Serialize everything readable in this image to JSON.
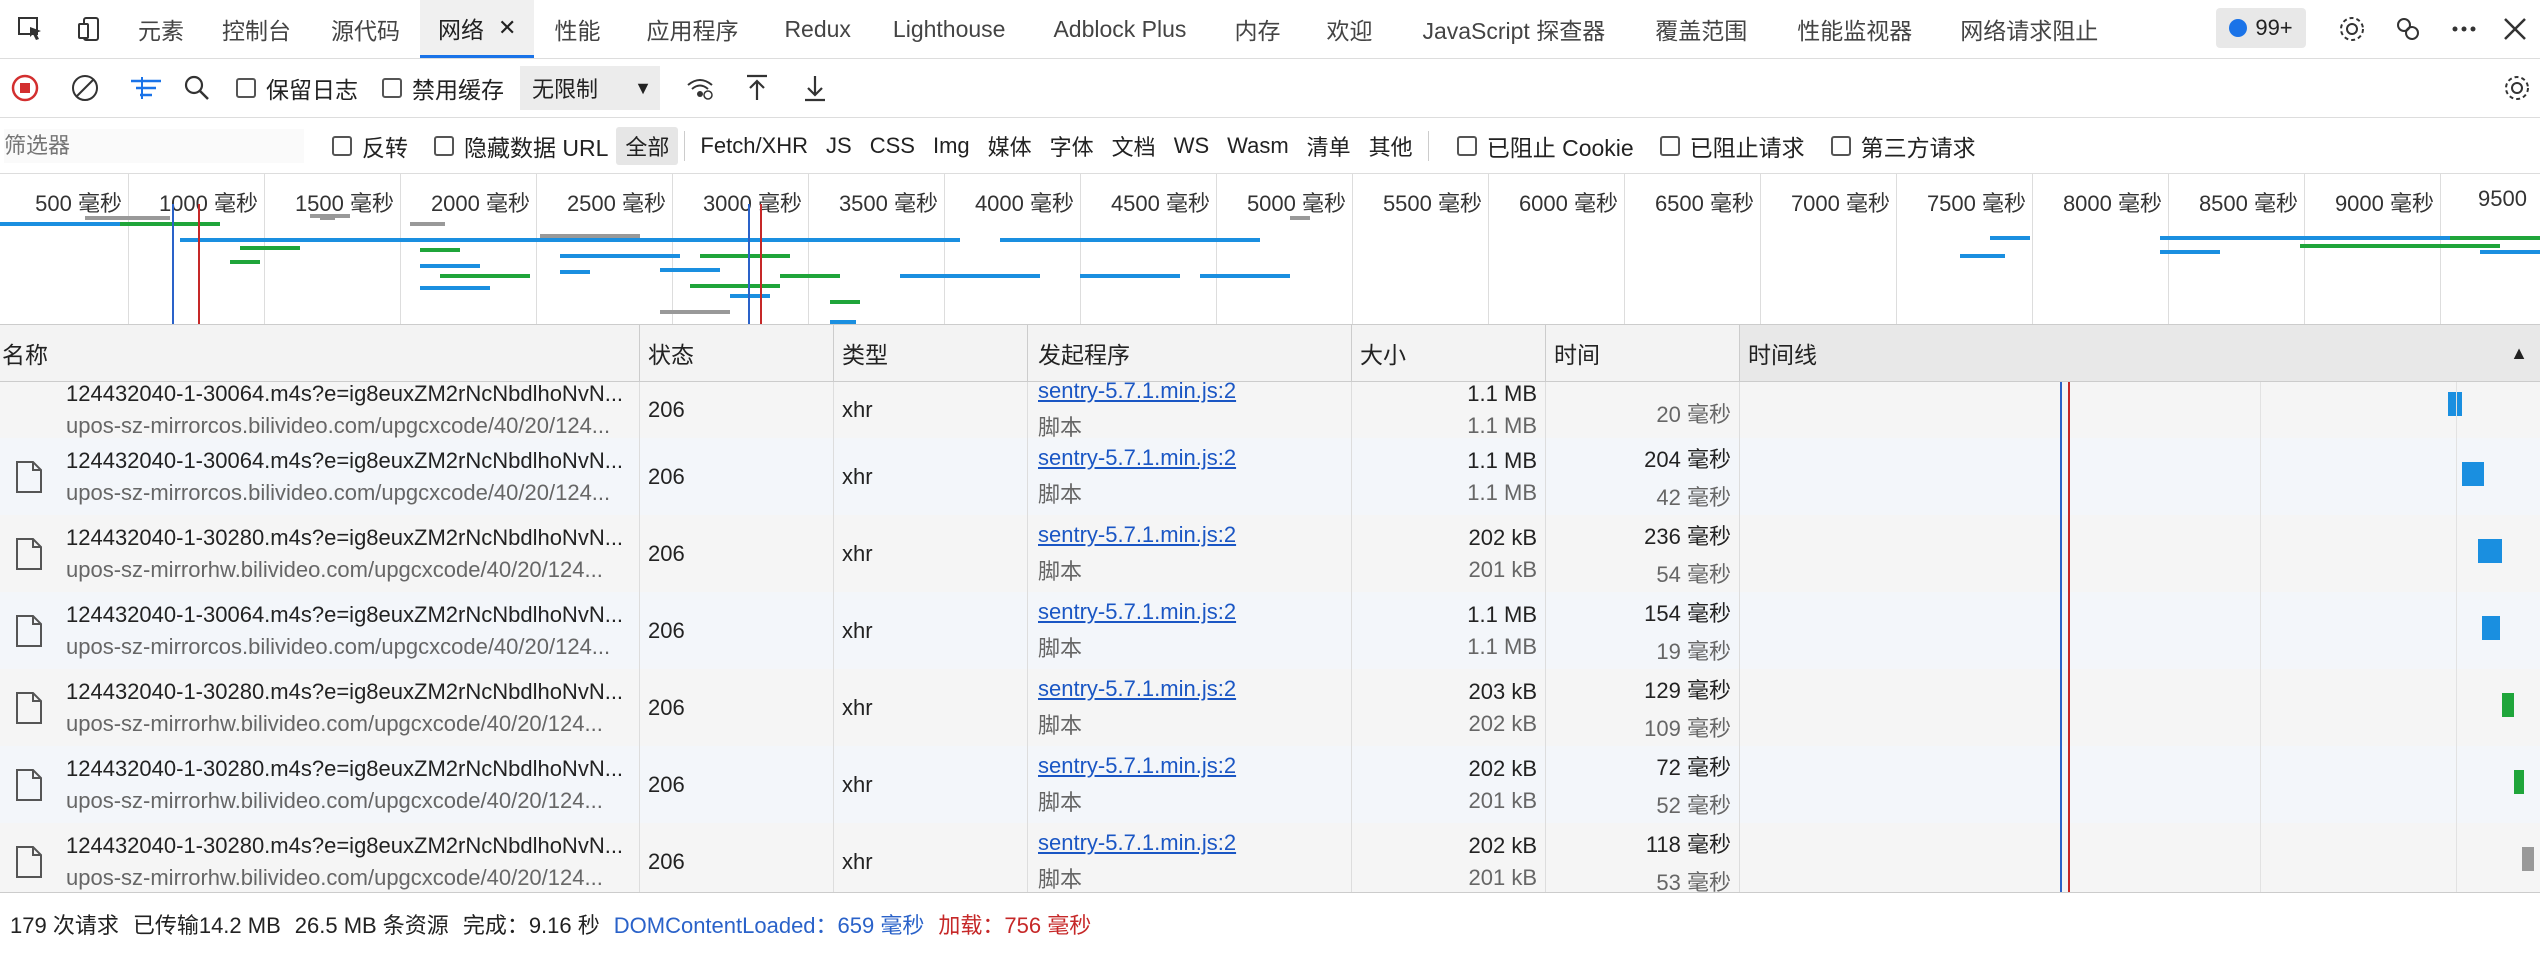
{
  "tabs": [
    {
      "label": "元素"
    },
    {
      "label": "控制台"
    },
    {
      "label": "源代码"
    },
    {
      "label": "网络",
      "active": true
    },
    {
      "label": "性能"
    },
    {
      "label": "应用程序"
    },
    {
      "label": "Redux"
    },
    {
      "label": "Lighthouse"
    },
    {
      "label": "Adblock Plus"
    },
    {
      "label": "内存"
    },
    {
      "label": "欢迎"
    },
    {
      "label": "JavaScript 探查器"
    },
    {
      "label": "覆盖范围"
    },
    {
      "label": "性能监视器"
    },
    {
      "label": "网络请求阻止"
    }
  ],
  "issues_badge": "99+",
  "toolbar": {
    "preserve_log": "保留日志",
    "disable_cache": "禁用缓存",
    "throttling": "无限制"
  },
  "filterbar": {
    "placeholder": "筛选器",
    "invert": "反转",
    "hide_data_url": "隐藏数据 URL",
    "types": [
      "全部",
      "Fetch/XHR",
      "JS",
      "CSS",
      "Img",
      "媒体",
      "字体",
      "文档",
      "WS",
      "Wasm",
      "清单",
      "其他"
    ],
    "blocked_cookies": "已阻止 Cookie",
    "blocked_requests": "已阻止请求",
    "third_party": "第三方请求"
  },
  "overview_ticks": [
    "500 毫秒",
    "1000 毫秒",
    "1500 毫秒",
    "2000 毫秒",
    "2500 毫秒",
    "3000 毫秒",
    "3500 毫秒",
    "4000 毫秒",
    "4500 毫秒",
    "5000 毫秒",
    "5500 毫秒",
    "6000 毫秒",
    "6500 毫秒",
    "7000 毫秒",
    "7500 毫秒",
    "8000 毫秒",
    "8500 毫秒",
    "9000 毫秒",
    "9500"
  ],
  "columns": {
    "name": "名称",
    "status": "状态",
    "type": "类型",
    "initiator": "发起程序",
    "size": "大小",
    "time": "时间",
    "timeline": "时间线"
  },
  "rows": [
    {
      "name": "124432040-1-30064.m4s?e=ig8euxZM2rNcNbdlhoNvN...",
      "url": "upos-sz-mirrorcos.bilivideo.com/upgcxcode/40/20/124...",
      "status": "206",
      "type": "xhr",
      "initiator": "sentry-5.7.1.min.js:2",
      "initiator_type": "脚本",
      "size": "1.1 MB",
      "size2": "1.1 MB",
      "time": "",
      "time2": "20 毫秒",
      "partial": true
    },
    {
      "name": "124432040-1-30064.m4s?e=ig8euxZM2rNcNbdlhoNvN...",
      "url": "upos-sz-mirrorcos.bilivideo.com/upgcxcode/40/20/124...",
      "status": "206",
      "type": "xhr",
      "initiator": "sentry-5.7.1.min.js:2",
      "initiator_type": "脚本",
      "size": "1.1 MB",
      "size2": "1.1 MB",
      "time": "204 毫秒",
      "time2": "42 毫秒"
    },
    {
      "name": "124432040-1-30280.m4s?e=ig8euxZM2rNcNbdlhoNvN...",
      "url": "upos-sz-mirrorhw.bilivideo.com/upgcxcode/40/20/124...",
      "status": "206",
      "type": "xhr",
      "initiator": "sentry-5.7.1.min.js:2",
      "initiator_type": "脚本",
      "size": "202 kB",
      "size2": "201 kB",
      "time": "236 毫秒",
      "time2": "54 毫秒"
    },
    {
      "name": "124432040-1-30064.m4s?e=ig8euxZM2rNcNbdlhoNvN...",
      "url": "upos-sz-mirrorcos.bilivideo.com/upgcxcode/40/20/124...",
      "status": "206",
      "type": "xhr",
      "initiator": "sentry-5.7.1.min.js:2",
      "initiator_type": "脚本",
      "size": "1.1 MB",
      "size2": "1.1 MB",
      "time": "154 毫秒",
      "time2": "19 毫秒"
    },
    {
      "name": "124432040-1-30280.m4s?e=ig8euxZM2rNcNbdlhoNvN...",
      "url": "upos-sz-mirrorhw.bilivideo.com/upgcxcode/40/20/124...",
      "status": "206",
      "type": "xhr",
      "initiator": "sentry-5.7.1.min.js:2",
      "initiator_type": "脚本",
      "size": "203 kB",
      "size2": "202 kB",
      "time": "129 毫秒",
      "time2": "109 毫秒"
    },
    {
      "name": "124432040-1-30280.m4s?e=ig8euxZM2rNcNbdlhoNvN...",
      "url": "upos-sz-mirrorhw.bilivideo.com/upgcxcode/40/20/124...",
      "status": "206",
      "type": "xhr",
      "initiator": "sentry-5.7.1.min.js:2",
      "initiator_type": "脚本",
      "size": "202 kB",
      "size2": "201 kB",
      "time": "72 毫秒",
      "time2": "52 毫秒"
    },
    {
      "name": "124432040-1-30280.m4s?e=ig8euxZM2rNcNbdlhoNvN...",
      "url": "upos-sz-mirrorhw.bilivideo.com/upgcxcode/40/20/124...",
      "status": "206",
      "type": "xhr",
      "initiator": "sentry-5.7.1.min.js:2",
      "initiator_type": "脚本",
      "size": "202 kB",
      "size2": "201 kB",
      "time": "118 毫秒",
      "time2": "53 毫秒"
    }
  ],
  "statusbar": {
    "requests": "179 次请求",
    "transferred": "已传输14.2 MB",
    "resources": "26.5 MB 条资源",
    "finish": "完成：9.16 秒",
    "dcl_label": "DOMContentLoaded：",
    "dcl_value": "659 毫秒",
    "load_label": "加载：",
    "load_value": "756 毫秒"
  },
  "colors": {
    "accent": "#1a73e8",
    "dcl": "#2a62c9",
    "load": "#c62828",
    "bar_blue": "#1a8fe0",
    "bar_green": "#1fa53a"
  }
}
